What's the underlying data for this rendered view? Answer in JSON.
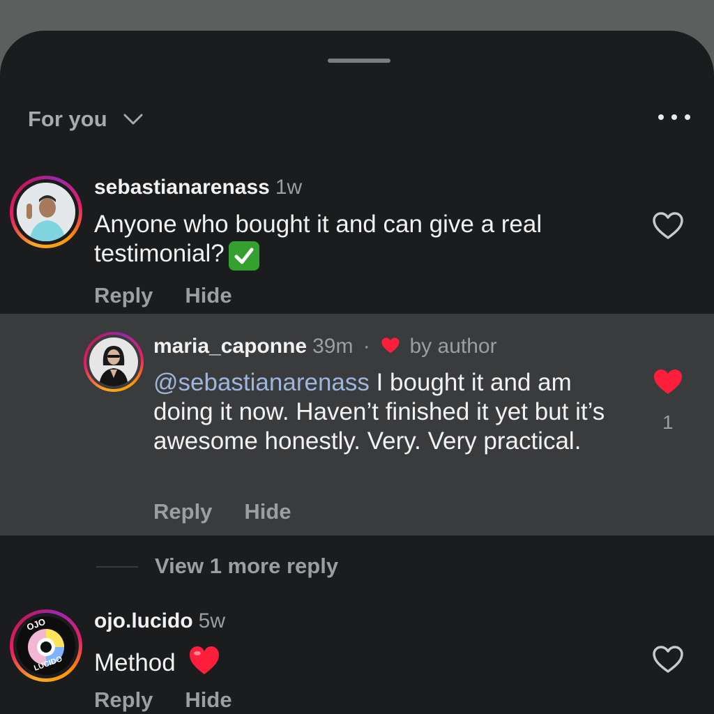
{
  "header": {
    "title": "For you"
  },
  "comments": [
    {
      "username": "sebastianarenass",
      "time": "1w",
      "text": "Anyone who bought it and can give a real testimonial?",
      "liked": false,
      "reply_label": "Reply",
      "hide_label": "Hide"
    },
    {
      "username": "maria_caponne",
      "time": "39m",
      "separator": "·",
      "by_author": "by author",
      "mention": "@sebastianarenass",
      "text": " I bought it and am doing it now. Haven’t finished it yet but it’s awesome honestly. Very. Very practical.",
      "liked": true,
      "like_count": "1",
      "reply_label": "Reply",
      "hide_label": "Hide"
    },
    {
      "username": "ojo.lucido",
      "time": "5w",
      "text": "Method",
      "liked": false,
      "reply_label": "Reply",
      "hide_label": "Hide"
    }
  ],
  "view_more": "View 1 more reply",
  "avatar_logo": {
    "top_text": "OJO",
    "bottom_text": "LUCIDO"
  },
  "colors": {
    "accent_heart": "#ff1f3d",
    "mention": "#9fb6dc"
  }
}
